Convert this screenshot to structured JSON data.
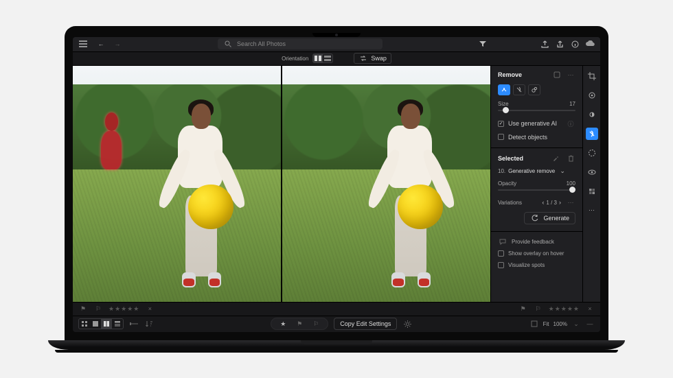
{
  "topbar": {
    "search_placeholder": "Search All Photos",
    "icons": {
      "menu": "menu-icon",
      "back": "arrow-left-icon",
      "forward": "arrow-right-icon",
      "search": "search-icon",
      "filter": "filter-icon",
      "share": "share-icon",
      "upload": "upload-icon",
      "comment": "comment-icon",
      "cloud": "cloud-icon"
    }
  },
  "viewbar": {
    "orientation_label": "Orientation",
    "swap_label": "Swap"
  },
  "panel": {
    "title": "Remove",
    "size_label": "Size",
    "size_value": "17",
    "use_gen_ai_label": "Use generative AI",
    "detect_objects_label": "Detect objects",
    "selected_label": "Selected",
    "selected_item_prefix": "10.",
    "selected_item_label": "Generative remove",
    "opacity_label": "Opacity",
    "opacity_value": "100",
    "variations_label": "Variations",
    "variations_page": "1 / 3",
    "generate_label": "Generate",
    "feedback_label": "Provide feedback",
    "show_overlay_label": "Show overlay on hover",
    "visualize_spots_label": "Visualize spots"
  },
  "filmstrip": {
    "stars": "★★★★★",
    "close": "×"
  },
  "bottombar": {
    "copy_label": "Copy Edit Settings",
    "fit_label": "Fit",
    "zoom_label": "100%"
  },
  "tool_icons": [
    "crop",
    "auto",
    "light",
    "color",
    "effects",
    "sharpen",
    "masking",
    "heal",
    "geometry",
    "presets",
    "more"
  ]
}
